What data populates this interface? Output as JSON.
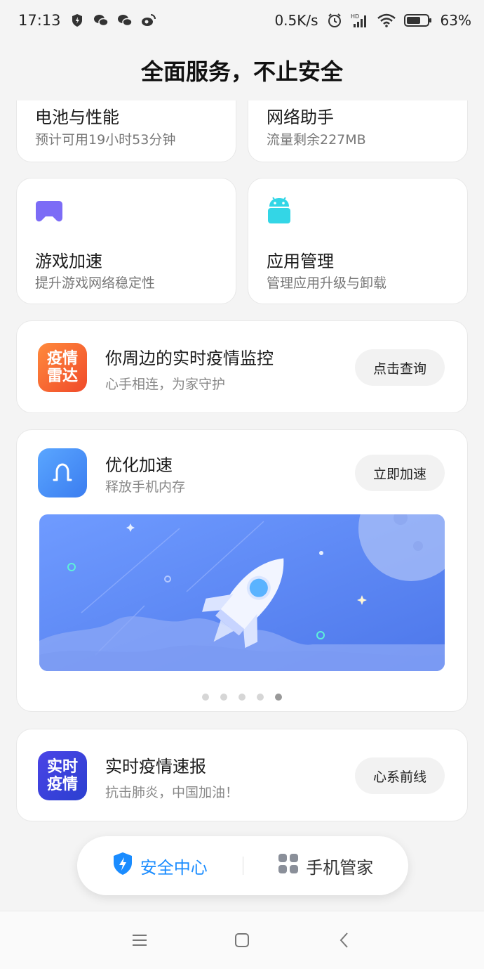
{
  "status_bar": {
    "time": "17:13",
    "speed": "0.5K/s",
    "battery": "63%",
    "icons_left": [
      "shield-icon",
      "wechat-icon",
      "wechat-icon",
      "weibo-icon"
    ],
    "icons_right": [
      "alarm-icon",
      "signal-icon",
      "wifi-icon",
      "battery-icon"
    ]
  },
  "header": {
    "title": "全面服务，不止安全"
  },
  "cards": {
    "battery": {
      "title": "电池与性能",
      "sub": "预计可用19小时53分钟"
    },
    "network": {
      "title": "网络助手",
      "sub": "流量剩余227MB"
    },
    "game": {
      "title": "游戏加速",
      "sub": "提升游戏网络稳定性",
      "icon": "gamepad-icon"
    },
    "apps": {
      "title": "应用管理",
      "sub": "管理应用升级与卸载",
      "icon": "android-icon"
    }
  },
  "radar": {
    "icon_line1": "疫情",
    "icon_line2": "雷达",
    "title": "你周边的实时疫情监控",
    "sub": "心手相连，为家守护",
    "button": "点击查询"
  },
  "optimize": {
    "title": "优化加速",
    "sub": "释放手机内存",
    "button": "立即加速",
    "carousel_count": 5,
    "carousel_active": 5
  },
  "news": {
    "icon_line1": "实时",
    "icon_line2": "疫情",
    "title": "实时疫情速报",
    "sub": "抗击肺炎，中国加油！",
    "button": "心系前线"
  },
  "bottom_tabs": {
    "security": {
      "label": "安全中心",
      "color": "#1a8cff"
    },
    "manager": {
      "label": "手机管家",
      "color": "#333333"
    }
  },
  "colors": {
    "accent": "#1a8cff",
    "game_icon": "#7c6cf6",
    "android_icon": "#33d6e6",
    "radar_icon": "#ff6a2c",
    "optimize_icon": "#4a8cf5",
    "news_icon": "#3a3fd8"
  }
}
